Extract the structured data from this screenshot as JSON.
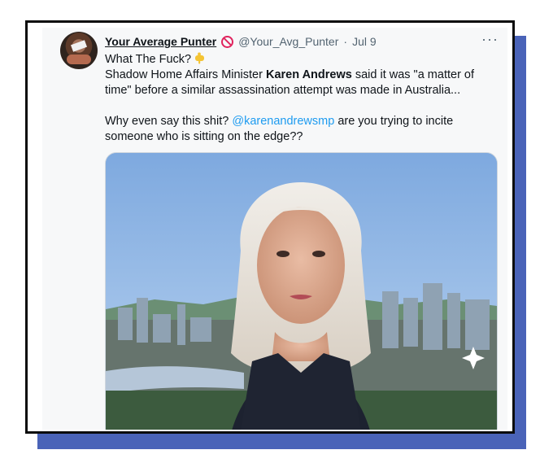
{
  "tweet": {
    "display_name": "Your Average Punter",
    "badge_icon": "no-entry-icon",
    "handle": "@Your_Avg_Punter",
    "separator": "·",
    "date": "Jul 9",
    "more_label": "···",
    "line1": "What The Fuck?",
    "line1_icon": "pointing-down-hand-icon",
    "line2_pre": "Shadow Home Affairs Minister ",
    "line2_strong": "Karen Andrews",
    "line2_post": " said it was \"a matter of time\" before a similar assassination attempt was made in Australia...",
    "line3_pre": "Why even say this shit? ",
    "line3_mention": "@karenandrewsmp",
    "line3_post": " are you trying to incite someone who is sitting on the edge??"
  },
  "colors": {
    "accent": "#1d9bf0",
    "badge": "#e0245e",
    "frame_shadow": "#4a63b8"
  }
}
